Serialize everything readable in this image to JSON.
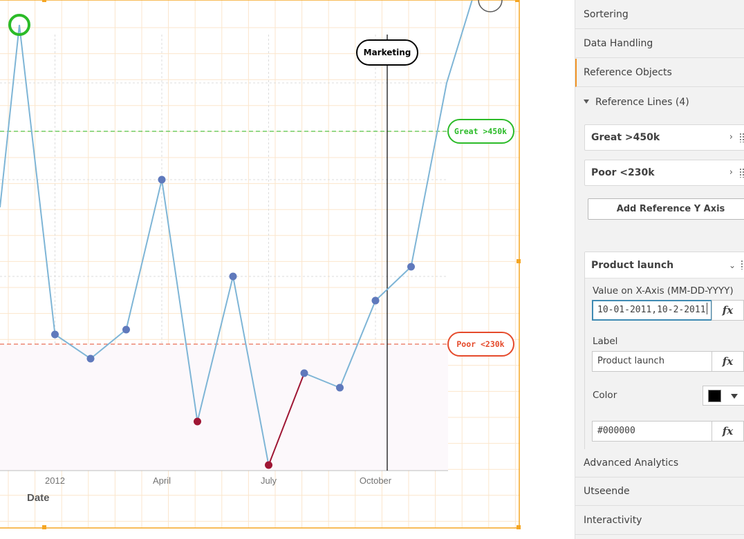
{
  "chart": {
    "x_axis_title": "Date",
    "x_tick_labels": [
      "2012",
      "April",
      "July",
      "October"
    ],
    "reference_lines": [
      {
        "label": "Great >450k",
        "color": "#2bbb28"
      },
      {
        "label": "Poor <230k",
        "color": "#e54a2b"
      }
    ],
    "dimension_line_label": "Marketing",
    "colors": {
      "line": "#7eb5d6",
      "point": "#5f79bc",
      "poor_point": "#9f1634",
      "great_marker": "#2bbb28",
      "frame": "#f5a623"
    }
  },
  "chart_data": {
    "type": "line",
    "xlabel": "Date",
    "ylabel": "",
    "x": [
      "2011-11",
      "2011-12",
      "2012-01",
      "2012-02",
      "2012-03",
      "2012-04",
      "2012-05",
      "2012-06",
      "2012-07",
      "2012-08",
      "2012-09",
      "2012-10",
      "2012-11",
      "2012-12"
    ],
    "values": [
      560,
      240,
      215,
      245,
      400,
      150,
      300,
      105,
      200,
      185,
      275,
      310,
      500,
      620
    ],
    "markers": [
      "great",
      "normal",
      "normal",
      "normal",
      "normal",
      "poor",
      "normal",
      "poor",
      "normal",
      "normal",
      "normal",
      "normal",
      "none",
      "great"
    ],
    "reference_lines_y": [
      {
        "label": "Great >450k",
        "value": 450
      },
      {
        "label": "Poor <230k",
        "value": 230
      }
    ],
    "vertical_reference": {
      "label": "Marketing",
      "x": "2012-10-15"
    },
    "grid": true
  },
  "panel": {
    "sections": {
      "sorting": "Sortering",
      "data_handling": "Data Handling",
      "reference_objects": "Reference Objects",
      "advanced_analytics": "Advanced Analytics",
      "appearance": "Utseende",
      "interactivity": "Interactivity"
    },
    "reference_lines_header": "Reference Lines (4)",
    "ref_items": [
      "Great >450k",
      "Poor <230k"
    ],
    "add_button": "Add Reference Y Axis",
    "product_launch": {
      "title": "Product launch",
      "value_label": "Value on X-Axis (MM-DD-YYYY)",
      "value": "10-01-2011,10-2-2011",
      "label_label": "Label",
      "label_value": "Product launch",
      "color_label": "Color",
      "color_hex": "#000000",
      "fx": "fx"
    }
  }
}
